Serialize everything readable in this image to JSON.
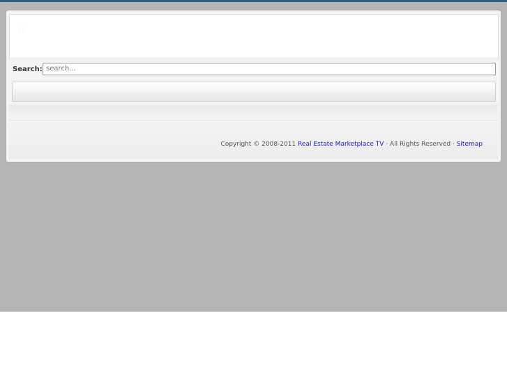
{
  "search": {
    "label": "Search:",
    "placeholder": "search..."
  },
  "footer": {
    "copyright_prefix": "Copyright © 2008-2011",
    "site_link": "Real Estate Marketplace TV",
    "rights_text": "· All Rights Reserved ·",
    "sitemap_link": "Sitemap"
  },
  "colors": {
    "page_background": "#b5b5b5",
    "top_strip": "#2f5f86",
    "link": "#1a1acc"
  }
}
